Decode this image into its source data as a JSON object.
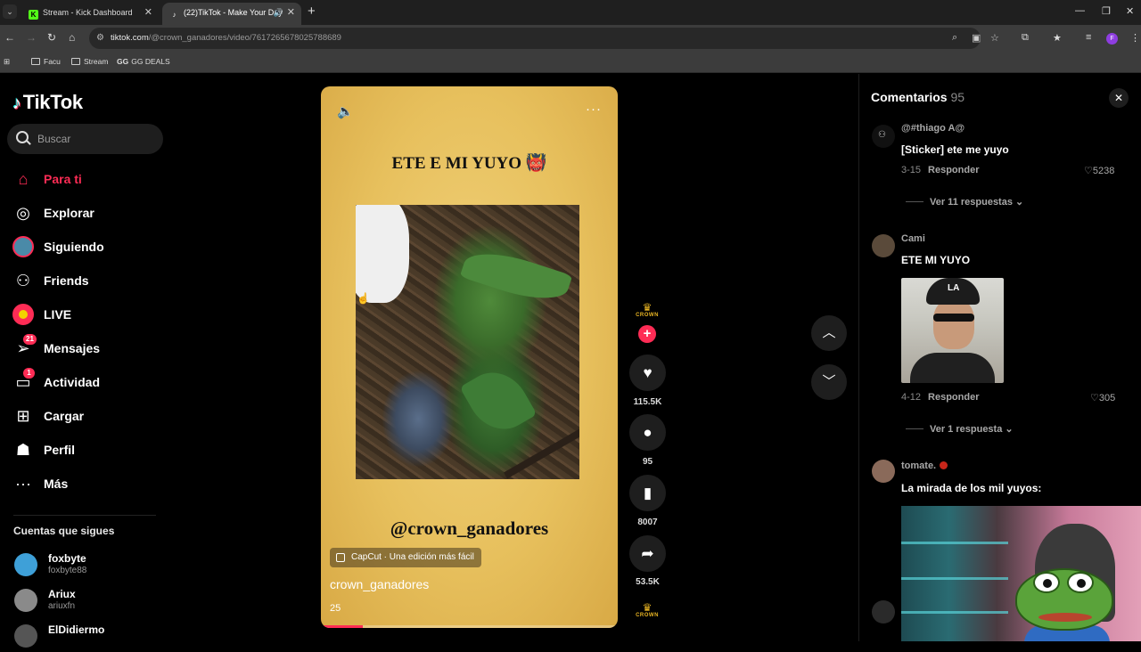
{
  "browser": {
    "tabs": [
      {
        "title": "Stream - Kick Dashboard",
        "favicon": "kick-icon",
        "active": false
      },
      {
        "title": "(22)TikTok - Make Your Day",
        "favicon": "tiktok-icon",
        "active": true
      }
    ],
    "url_host": "tiktok.com",
    "url_path": "/@crown_ganadores/video/7617265678025788689",
    "profile_initial": "F",
    "bookmarks": [
      {
        "label": "Facu",
        "icon": "folder-icon"
      },
      {
        "label": "Stream",
        "icon": "folder-icon"
      },
      {
        "label": "GG DEALS",
        "icon": "gg-deals-icon"
      }
    ]
  },
  "sidebar": {
    "logo": "TikTok",
    "search_placeholder": "Buscar",
    "items": [
      {
        "label": "Para ti",
        "icon": "home-icon",
        "active": true
      },
      {
        "label": "Explorar",
        "icon": "compass-icon"
      },
      {
        "label": "Siguiendo",
        "icon": "following-avatar-icon"
      },
      {
        "label": "Friends",
        "icon": "friends-icon"
      },
      {
        "label": "LIVE",
        "icon": "live-icon"
      },
      {
        "label": "Mensajes",
        "icon": "send-icon",
        "badge": "21"
      },
      {
        "label": "Actividad",
        "icon": "activity-icon",
        "badge": "1"
      },
      {
        "label": "Cargar",
        "icon": "upload-icon"
      },
      {
        "label": "Perfil",
        "icon": "profile-icon"
      },
      {
        "label": "Más",
        "icon": "more-icon"
      }
    ],
    "following_title": "Cuentas que sigues",
    "following": [
      {
        "name": "foxbyte",
        "username": "foxbyte88"
      },
      {
        "name": "Ariux",
        "username": "ariuxfn"
      },
      {
        "name": "ElDidiermo",
        "username": ""
      }
    ]
  },
  "video": {
    "caption": "ETE E MI YUYO",
    "caption_emoji": "👹",
    "watermark_handle": "@crown_ganadores",
    "capcut_label": "CapCut · Una edición más fácil",
    "author": "crown_ganadores",
    "description": "25",
    "progress": 0.14
  },
  "actions": {
    "creator_badge": "CROWN",
    "likes": "115.5K",
    "comments": "95",
    "saves": "8007",
    "shares": "53.5K"
  },
  "comments": {
    "title": "Comentarios",
    "count": "95",
    "items": [
      {
        "user": "@#thiago A@",
        "text": "[Sticker] ete me yuyo",
        "date": "3-15",
        "reply": "Responder",
        "likes": "5238",
        "more": "Ver 11 respuestas"
      },
      {
        "user": "Cami",
        "text": "ETE MI YUYO",
        "date": "4-12",
        "reply": "Responder",
        "likes": "305",
        "more": "Ver 1 respuesta"
      },
      {
        "user": "tomate.",
        "text": "La mirada de los mil yuyos:"
      }
    ]
  },
  "colors": {
    "accent": "#fe2c55",
    "video_bg": "#e7c05d",
    "panel_bg": "#000000"
  }
}
